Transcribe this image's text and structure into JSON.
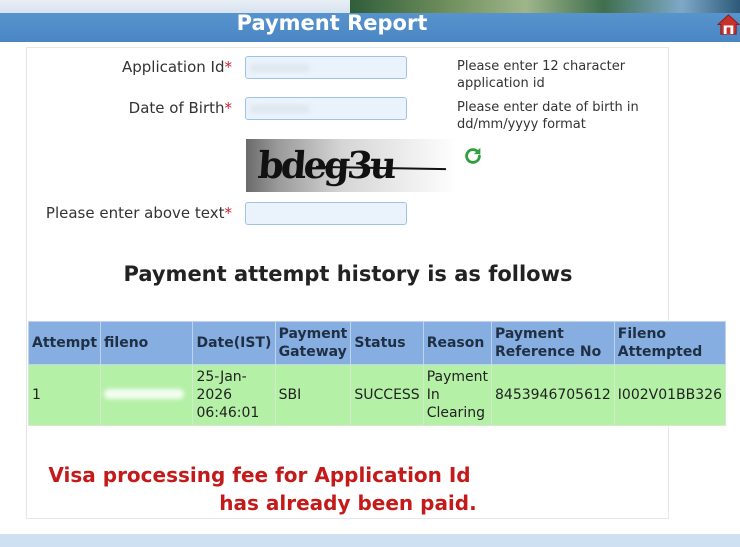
{
  "header": {
    "title": "Payment Report"
  },
  "form": {
    "application_id": {
      "label": "Application Id",
      "required_mark": "*",
      "hint": "Please enter 12 character application id"
    },
    "date_of_birth": {
      "label": "Date of Birth",
      "required_mark": "*",
      "hint": "Please enter date of birth in dd/mm/yyyy format"
    },
    "captcha": {
      "text": "bdeg3u",
      "input_label": "Please enter above text",
      "required_mark": "*"
    }
  },
  "history": {
    "title": "Payment attempt history is as follows",
    "columns": [
      "Attempt",
      "fileno",
      "Date(IST)",
      "Payment Gateway",
      "Status",
      "Reason",
      "Payment Reference No",
      "Fileno Attempted"
    ],
    "rows": [
      {
        "attempt": "1",
        "fileno": "",
        "date": "25-Jan-2026 06:46:01",
        "gateway": "SBI",
        "status": "SUCCESS",
        "reason": "Payment In Clearing",
        "reference": "8453946705612",
        "fileno_attempted": "I002V01BB326"
      }
    ]
  },
  "message": {
    "line1": "Visa processing fee for Application Id",
    "line2": "has already been paid."
  },
  "colors": {
    "header_blue": "#4a86c4",
    "table_header": "#87aee0",
    "row_green": "#b5f0a7",
    "alert_red": "#c41a1a"
  },
  "icons": [
    "home-icon",
    "refresh-icon"
  ]
}
